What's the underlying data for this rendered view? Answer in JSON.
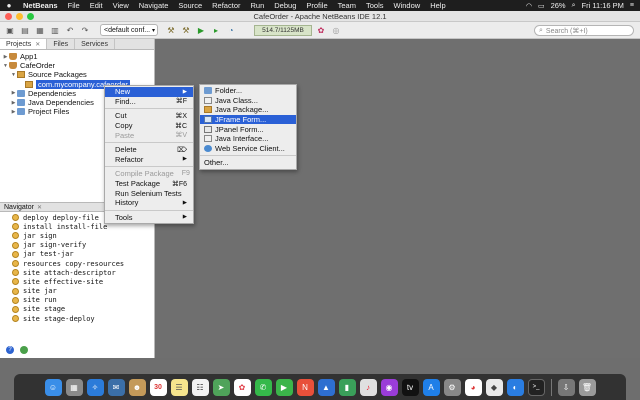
{
  "menubar": {
    "app": "NetBeans",
    "items": [
      "File",
      "Edit",
      "View",
      "Navigate",
      "Source",
      "Refactor",
      "Run",
      "Debug",
      "Profile",
      "Team",
      "Tools",
      "Window",
      "Help"
    ],
    "battery": "26%",
    "clock": "Fri 11:16 PM"
  },
  "window": {
    "title": "CafeOrder - Apache NetBeans IDE 12.1"
  },
  "toolbar": {
    "config": "<default conf...",
    "memory": "514.7/1125MB",
    "search_placeholder": "Search (⌘+I)"
  },
  "projects": {
    "tabs": [
      "Projects",
      "Files",
      "Services"
    ],
    "tree": [
      "App1",
      "CafeOrder",
      "Source Packages",
      "com.mycompany.cafeorder",
      "Dependencies",
      "Java Dependencies",
      "Project Files"
    ]
  },
  "navigator": {
    "title": "Navigator",
    "goals": [
      "deploy deploy-file",
      "install install-file",
      "jar sign",
      "jar sign-verify",
      "jar test-jar",
      "resources copy-resources",
      "site attach-descriptor",
      "site effective-site",
      "site jar",
      "site run",
      "site stage",
      "site stage-deploy"
    ]
  },
  "context_menu": {
    "new": "New",
    "find": "Find...",
    "find_sc": "⌘F",
    "cut": "Cut",
    "cut_sc": "⌘X",
    "copy": "Copy",
    "copy_sc": "⌘C",
    "paste": "Paste",
    "paste_sc": "⌘V",
    "delete": "Delete",
    "delete_sc": "⌦",
    "refactor": "Refactor",
    "compile": "Compile Package",
    "compile_sc": "F9",
    "test": "Test Package",
    "test_sc": "⌘F6",
    "selenium": "Run Selenium Tests",
    "history": "History",
    "tools": "Tools"
  },
  "new_submenu": {
    "folder": "Folder...",
    "java_class": "Java Class...",
    "java_package": "Java Package...",
    "jframe": "JFrame Form...",
    "jpanel": "JPanel Form...",
    "java_interface": "Java Interface...",
    "web_service": "Web Service Client...",
    "other": "Other..."
  },
  "dock": {
    "calendar_day": "30"
  },
  "colors": {
    "selection": "#2a60d6",
    "menubar": "#1e1e1e",
    "editor": "#6f6f6f"
  }
}
